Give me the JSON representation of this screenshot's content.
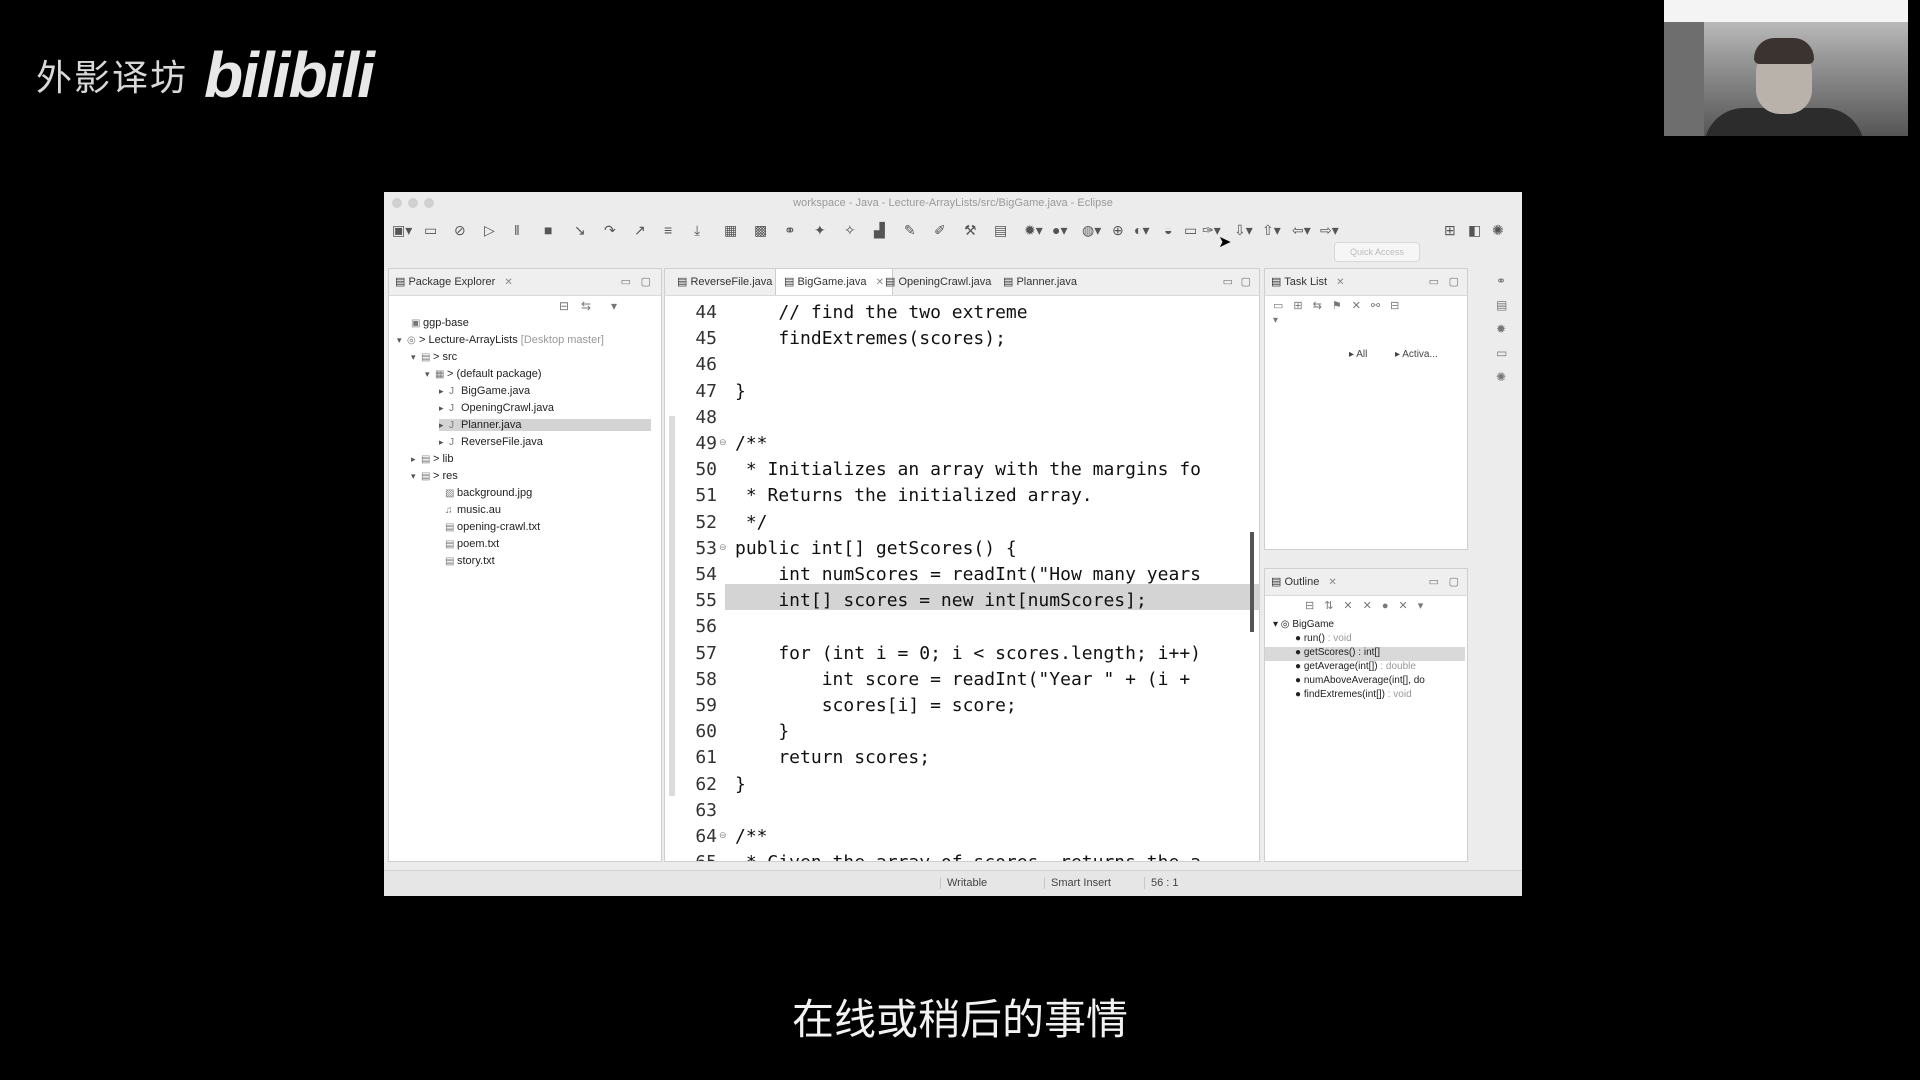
{
  "watermark": {
    "text": "外影译坊",
    "logo": "bilibili"
  },
  "subtitle": "在线或稍后的事情",
  "eclipse": {
    "window_title": "workspace - Java - Lecture-ArrayLists/src/BigGame.java - Eclipse",
    "quick_access_placeholder": "Quick Access",
    "package_explorer": {
      "title": "Package Explorer",
      "items": [
        {
          "label": "ggp-base",
          "decoration": ""
        },
        {
          "label": "> Lecture-ArrayLists",
          "decoration": "[Desktop master]"
        },
        {
          "label": "> src",
          "decoration": ""
        },
        {
          "label": "> (default package)",
          "decoration": ""
        },
        {
          "label": "BigGame.java",
          "decoration": ""
        },
        {
          "label": "OpeningCrawl.java",
          "decoration": ""
        },
        {
          "label": "Planner.java",
          "decoration": ""
        },
        {
          "label": "ReverseFile.java",
          "decoration": ""
        },
        {
          "label": "> lib",
          "decoration": ""
        },
        {
          "label": "> res",
          "decoration": ""
        },
        {
          "label": "background.jpg",
          "decoration": ""
        },
        {
          "label": "music.au",
          "decoration": ""
        },
        {
          "label": "opening-crawl.txt",
          "decoration": ""
        },
        {
          "label": "poem.txt",
          "decoration": ""
        },
        {
          "label": "story.txt",
          "decoration": ""
        }
      ]
    },
    "editor_tabs": [
      "ReverseFile.java",
      "BigGame.java",
      "OpeningCrawl.java",
      "Planner.java"
    ],
    "code_lines": [
      {
        "num": "44",
        "text": "    // find the two extreme"
      },
      {
        "num": "45",
        "text": "    findExtremes(scores);"
      },
      {
        "num": "46",
        "text": ""
      },
      {
        "num": "47",
        "text": "}"
      },
      {
        "num": "48",
        "text": ""
      },
      {
        "num": "49",
        "text": "/**"
      },
      {
        "num": "50",
        "text": " * Initializes an array with the margins fo"
      },
      {
        "num": "51",
        "text": " * Returns the initialized array."
      },
      {
        "num": "52",
        "text": " */"
      },
      {
        "num": "53",
        "text": "public int[] getScores() {"
      },
      {
        "num": "54",
        "text": "    int numScores = readInt(\"How many years"
      },
      {
        "num": "55",
        "text": "    int[] scores = new int[numScores];"
      },
      {
        "num": "56",
        "text": ""
      },
      {
        "num": "57",
        "text": "    for (int i = 0; i < scores.length; i++)"
      },
      {
        "num": "58",
        "text": "        int score = readInt(\"Year \" + (i +"
      },
      {
        "num": "59",
        "text": "        scores[i] = score;"
      },
      {
        "num": "60",
        "text": "    }"
      },
      {
        "num": "61",
        "text": "    return scores;"
      },
      {
        "num": "62",
        "text": "}"
      },
      {
        "num": "63",
        "text": ""
      },
      {
        "num": "64",
        "text": "/**"
      },
      {
        "num": "65",
        "text": " * Given the array of scores, returns the a"
      }
    ],
    "task_list": {
      "title": "Task List",
      "filter_all": "All",
      "filter_active": "Activa..."
    },
    "outline": {
      "title": "Outline",
      "class_name": "BigGame",
      "members": [
        {
          "name": "run()",
          "type": ": void"
        },
        {
          "name": "getScores() : int[]",
          "type": ""
        },
        {
          "name": "getAverage(int[])",
          "type": ": double"
        },
        {
          "name": "numAboveAverage(int[], do",
          "type": ""
        },
        {
          "name": "findExtremes(int[])",
          "type": ": void"
        }
      ]
    },
    "status_bar": {
      "writable": "Writable",
      "insert_mode": "Smart Insert",
      "position": "56 : 1"
    }
  }
}
